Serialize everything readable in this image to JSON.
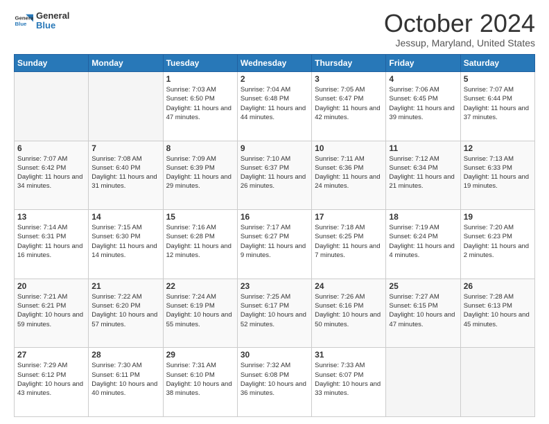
{
  "header": {
    "logo_general": "General",
    "logo_blue": "Blue",
    "month_title": "October 2024",
    "location": "Jessup, Maryland, United States"
  },
  "days_of_week": [
    "Sunday",
    "Monday",
    "Tuesday",
    "Wednesday",
    "Thursday",
    "Friday",
    "Saturday"
  ],
  "weeks": [
    [
      {
        "day": "",
        "sunrise": "",
        "sunset": "",
        "daylight": "",
        "empty": true
      },
      {
        "day": "",
        "sunrise": "",
        "sunset": "",
        "daylight": "",
        "empty": true
      },
      {
        "day": "1",
        "sunrise": "Sunrise: 7:03 AM",
        "sunset": "Sunset: 6:50 PM",
        "daylight": "Daylight: 11 hours and 47 minutes.",
        "empty": false
      },
      {
        "day": "2",
        "sunrise": "Sunrise: 7:04 AM",
        "sunset": "Sunset: 6:48 PM",
        "daylight": "Daylight: 11 hours and 44 minutes.",
        "empty": false
      },
      {
        "day": "3",
        "sunrise": "Sunrise: 7:05 AM",
        "sunset": "Sunset: 6:47 PM",
        "daylight": "Daylight: 11 hours and 42 minutes.",
        "empty": false
      },
      {
        "day": "4",
        "sunrise": "Sunrise: 7:06 AM",
        "sunset": "Sunset: 6:45 PM",
        "daylight": "Daylight: 11 hours and 39 minutes.",
        "empty": false
      },
      {
        "day": "5",
        "sunrise": "Sunrise: 7:07 AM",
        "sunset": "Sunset: 6:44 PM",
        "daylight": "Daylight: 11 hours and 37 minutes.",
        "empty": false
      }
    ],
    [
      {
        "day": "6",
        "sunrise": "Sunrise: 7:07 AM",
        "sunset": "Sunset: 6:42 PM",
        "daylight": "Daylight: 11 hours and 34 minutes.",
        "empty": false
      },
      {
        "day": "7",
        "sunrise": "Sunrise: 7:08 AM",
        "sunset": "Sunset: 6:40 PM",
        "daylight": "Daylight: 11 hours and 31 minutes.",
        "empty": false
      },
      {
        "day": "8",
        "sunrise": "Sunrise: 7:09 AM",
        "sunset": "Sunset: 6:39 PM",
        "daylight": "Daylight: 11 hours and 29 minutes.",
        "empty": false
      },
      {
        "day": "9",
        "sunrise": "Sunrise: 7:10 AM",
        "sunset": "Sunset: 6:37 PM",
        "daylight": "Daylight: 11 hours and 26 minutes.",
        "empty": false
      },
      {
        "day": "10",
        "sunrise": "Sunrise: 7:11 AM",
        "sunset": "Sunset: 6:36 PM",
        "daylight": "Daylight: 11 hours and 24 minutes.",
        "empty": false
      },
      {
        "day": "11",
        "sunrise": "Sunrise: 7:12 AM",
        "sunset": "Sunset: 6:34 PM",
        "daylight": "Daylight: 11 hours and 21 minutes.",
        "empty": false
      },
      {
        "day": "12",
        "sunrise": "Sunrise: 7:13 AM",
        "sunset": "Sunset: 6:33 PM",
        "daylight": "Daylight: 11 hours and 19 minutes.",
        "empty": false
      }
    ],
    [
      {
        "day": "13",
        "sunrise": "Sunrise: 7:14 AM",
        "sunset": "Sunset: 6:31 PM",
        "daylight": "Daylight: 11 hours and 16 minutes.",
        "empty": false
      },
      {
        "day": "14",
        "sunrise": "Sunrise: 7:15 AM",
        "sunset": "Sunset: 6:30 PM",
        "daylight": "Daylight: 11 hours and 14 minutes.",
        "empty": false
      },
      {
        "day": "15",
        "sunrise": "Sunrise: 7:16 AM",
        "sunset": "Sunset: 6:28 PM",
        "daylight": "Daylight: 11 hours and 12 minutes.",
        "empty": false
      },
      {
        "day": "16",
        "sunrise": "Sunrise: 7:17 AM",
        "sunset": "Sunset: 6:27 PM",
        "daylight": "Daylight: 11 hours and 9 minutes.",
        "empty": false
      },
      {
        "day": "17",
        "sunrise": "Sunrise: 7:18 AM",
        "sunset": "Sunset: 6:25 PM",
        "daylight": "Daylight: 11 hours and 7 minutes.",
        "empty": false
      },
      {
        "day": "18",
        "sunrise": "Sunrise: 7:19 AM",
        "sunset": "Sunset: 6:24 PM",
        "daylight": "Daylight: 11 hours and 4 minutes.",
        "empty": false
      },
      {
        "day": "19",
        "sunrise": "Sunrise: 7:20 AM",
        "sunset": "Sunset: 6:23 PM",
        "daylight": "Daylight: 11 hours and 2 minutes.",
        "empty": false
      }
    ],
    [
      {
        "day": "20",
        "sunrise": "Sunrise: 7:21 AM",
        "sunset": "Sunset: 6:21 PM",
        "daylight": "Daylight: 10 hours and 59 minutes.",
        "empty": false
      },
      {
        "day": "21",
        "sunrise": "Sunrise: 7:22 AM",
        "sunset": "Sunset: 6:20 PM",
        "daylight": "Daylight: 10 hours and 57 minutes.",
        "empty": false
      },
      {
        "day": "22",
        "sunrise": "Sunrise: 7:24 AM",
        "sunset": "Sunset: 6:19 PM",
        "daylight": "Daylight: 10 hours and 55 minutes.",
        "empty": false
      },
      {
        "day": "23",
        "sunrise": "Sunrise: 7:25 AM",
        "sunset": "Sunset: 6:17 PM",
        "daylight": "Daylight: 10 hours and 52 minutes.",
        "empty": false
      },
      {
        "day": "24",
        "sunrise": "Sunrise: 7:26 AM",
        "sunset": "Sunset: 6:16 PM",
        "daylight": "Daylight: 10 hours and 50 minutes.",
        "empty": false
      },
      {
        "day": "25",
        "sunrise": "Sunrise: 7:27 AM",
        "sunset": "Sunset: 6:15 PM",
        "daylight": "Daylight: 10 hours and 47 minutes.",
        "empty": false
      },
      {
        "day": "26",
        "sunrise": "Sunrise: 7:28 AM",
        "sunset": "Sunset: 6:13 PM",
        "daylight": "Daylight: 10 hours and 45 minutes.",
        "empty": false
      }
    ],
    [
      {
        "day": "27",
        "sunrise": "Sunrise: 7:29 AM",
        "sunset": "Sunset: 6:12 PM",
        "daylight": "Daylight: 10 hours and 43 minutes.",
        "empty": false
      },
      {
        "day": "28",
        "sunrise": "Sunrise: 7:30 AM",
        "sunset": "Sunset: 6:11 PM",
        "daylight": "Daylight: 10 hours and 40 minutes.",
        "empty": false
      },
      {
        "day": "29",
        "sunrise": "Sunrise: 7:31 AM",
        "sunset": "Sunset: 6:10 PM",
        "daylight": "Daylight: 10 hours and 38 minutes.",
        "empty": false
      },
      {
        "day": "30",
        "sunrise": "Sunrise: 7:32 AM",
        "sunset": "Sunset: 6:08 PM",
        "daylight": "Daylight: 10 hours and 36 minutes.",
        "empty": false
      },
      {
        "day": "31",
        "sunrise": "Sunrise: 7:33 AM",
        "sunset": "Sunset: 6:07 PM",
        "daylight": "Daylight: 10 hours and 33 minutes.",
        "empty": false
      },
      {
        "day": "",
        "sunrise": "",
        "sunset": "",
        "daylight": "",
        "empty": true
      },
      {
        "day": "",
        "sunrise": "",
        "sunset": "",
        "daylight": "",
        "empty": true
      }
    ]
  ]
}
